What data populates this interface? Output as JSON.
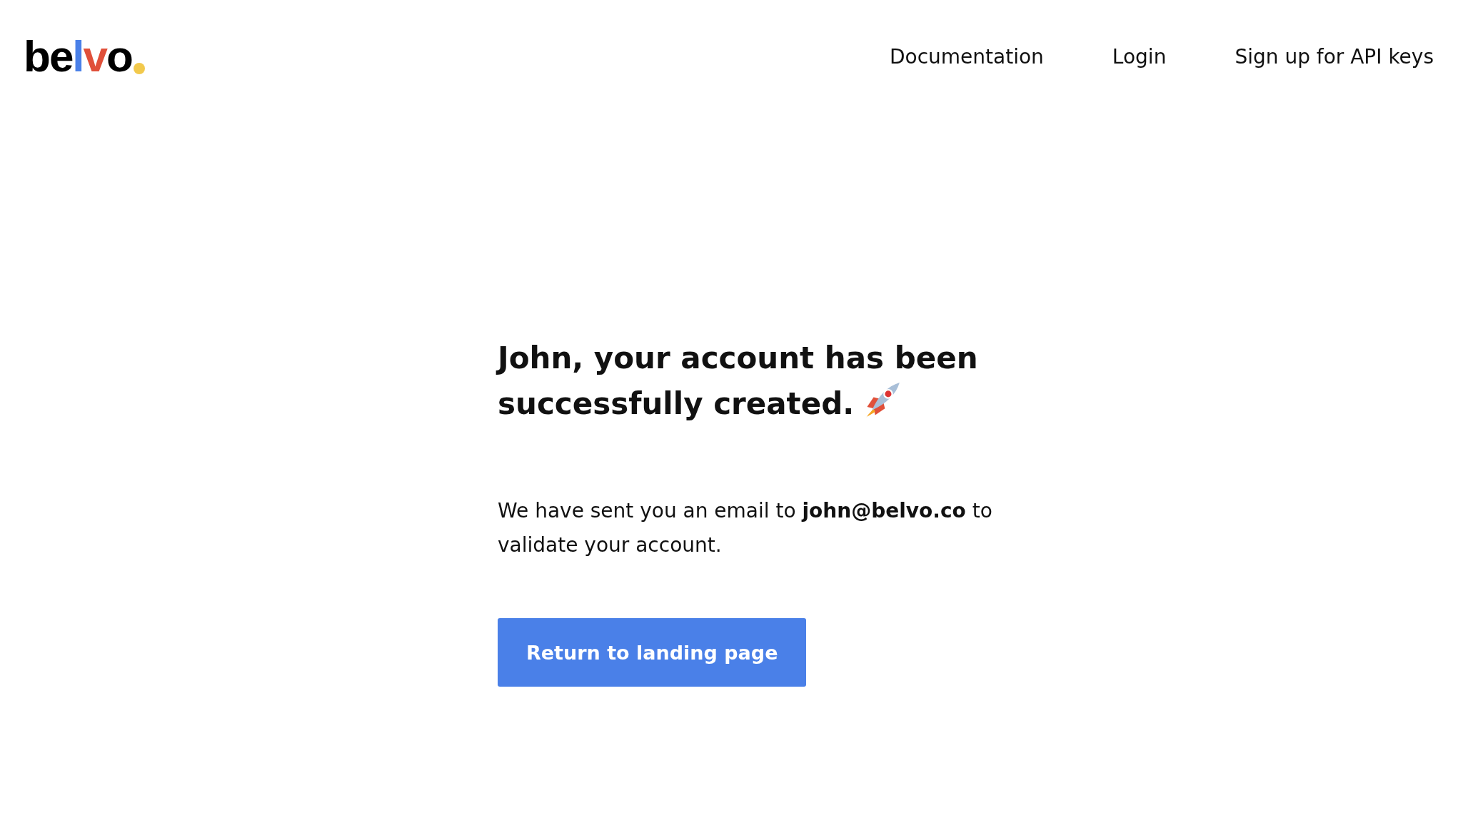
{
  "logo": {
    "letters": [
      {
        "text": "b",
        "color": "#000000"
      },
      {
        "text": "e",
        "color": "#000000"
      },
      {
        "text": "l",
        "color": "#4a80e8"
      },
      {
        "text": "v",
        "color": "#e0503a"
      },
      {
        "text": "o",
        "color": "#000000"
      }
    ],
    "dot": {
      "color": "#f2c94c"
    }
  },
  "nav": [
    "Documentation",
    "Login",
    "Sign up for API keys"
  ],
  "heading": "John, your account has been successfully created.",
  "message": "We have sent you an email to **john@belvo.co** to validate your account.",
  "button": "Return to landing page"
}
